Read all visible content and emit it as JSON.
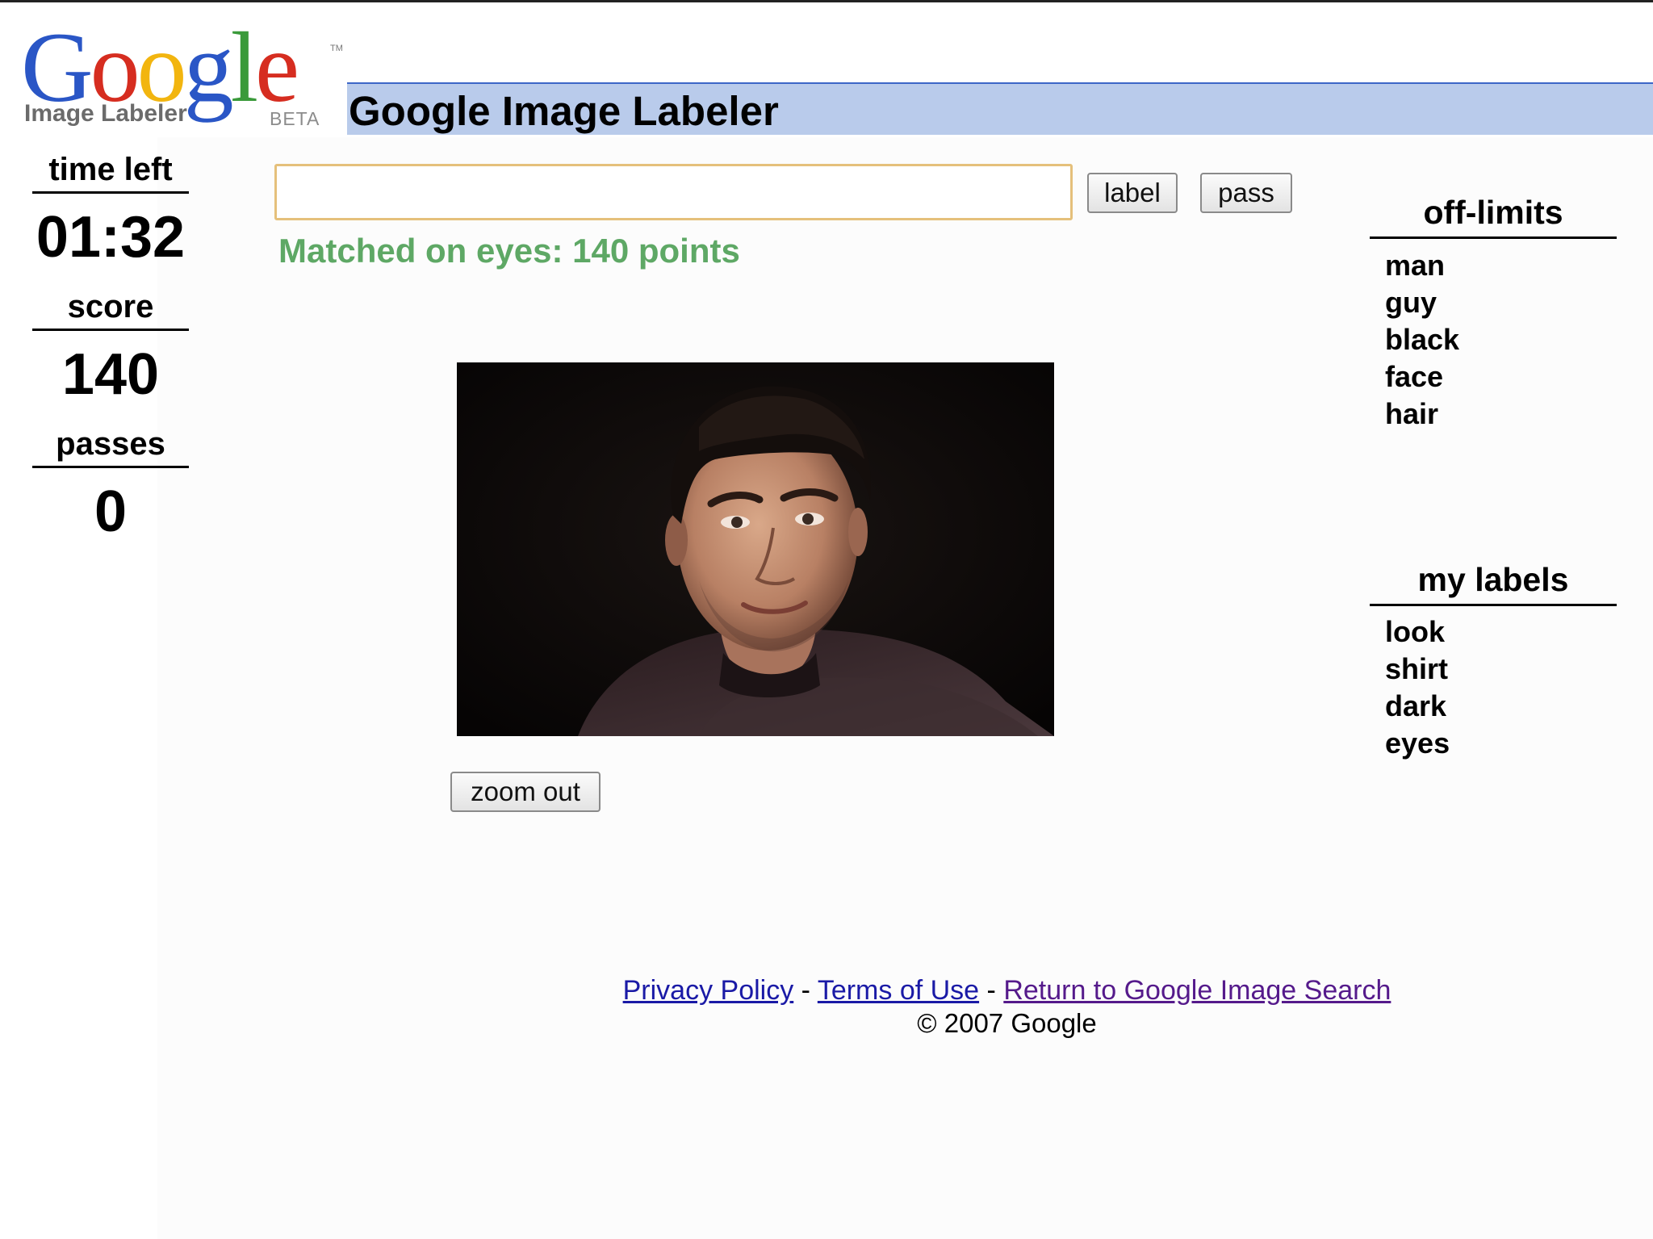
{
  "logo": {
    "letters": [
      {
        "char": "G",
        "color": "#2a56c6"
      },
      {
        "char": "o",
        "color": "#d62d20"
      },
      {
        "char": "o",
        "color": "#f2b50f"
      },
      {
        "char": "g",
        "color": "#2a56c6"
      },
      {
        "char": "l",
        "color": "#3a9a3a"
      },
      {
        "char": "e",
        "color": "#d62d20"
      }
    ],
    "subtitle": "Image Labeler",
    "beta": "BETA",
    "tm": "TM"
  },
  "header": {
    "title": "Google Image Labeler",
    "bar_color": "#b9cbeb"
  },
  "stats": {
    "time_left_label": "time left",
    "time_left_value": "01:32",
    "score_label": "score",
    "score_value": "140",
    "passes_label": "passes",
    "passes_value": "0"
  },
  "controls": {
    "input_value": "",
    "label_button": "label",
    "pass_button": "pass",
    "zoom_button": "zoom out"
  },
  "status": {
    "match_message": "Matched on eyes: 140 points",
    "color": "#5ea865"
  },
  "image": {
    "subject": "portrait-photo-man-dark-background"
  },
  "off_limits": {
    "heading": "off-limits",
    "items": [
      "man",
      "guy",
      "black",
      "face",
      "hair"
    ]
  },
  "my_labels": {
    "heading": "my labels",
    "items": [
      "look",
      "shirt",
      "dark",
      "eyes"
    ]
  },
  "footer": {
    "privacy": "Privacy Policy",
    "sep1": " - ",
    "terms": "Terms of Use",
    "sep2": " - ",
    "return_link": "Return to Google Image Search",
    "copyright": "© 2007 Google"
  }
}
